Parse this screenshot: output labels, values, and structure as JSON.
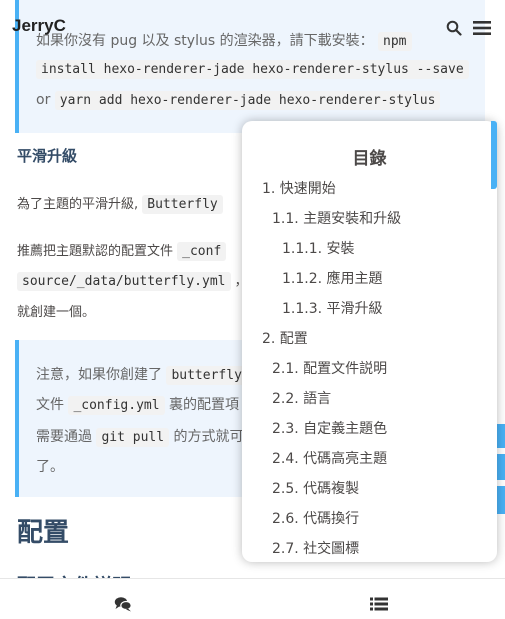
{
  "header": {
    "site_name": "JerryC"
  },
  "article": {
    "note1": {
      "line1": "如果你沒有 pug 以及 stylus 的渲染器，請下載安裝：",
      "line1_code": "npm",
      "line2_code": "install hexo-renderer-jade hexo-renderer-stylus --save",
      "line3_or": "or",
      "line3_code": "yarn add hexo-renderer-jade hexo-renderer-stylus"
    },
    "heading_smooth": "平滑升級",
    "para1_text": "為了主題的平滑升級,",
    "para1_code": "Butterfly",
    "para2_text": "推薦把主題默認的配置文件",
    "para2_code": "_conf",
    "para3_code": "source/_data/butterfly.yml",
    "para3_suffix": "，",
    "para4_text": "就創建一個。",
    "note2": {
      "l1_text": "注意，如果你創建了",
      "l1_code": "butterfly",
      "l2_text": "文件",
      "l2_code": "_config.yml",
      "l2_suffix": "裏的配置項",
      "l3_text": "需要通過",
      "l3_code": "git pull",
      "l3_suffix": "的方式就可",
      "l4_text": "了。"
    },
    "heading_config": "配置",
    "heading_config_file": "配置文件説明"
  },
  "toc": {
    "title": "目錄",
    "items": [
      "1. 快速開始",
      "1.1. 主題安裝和升級",
      "1.1.1. 安裝",
      "1.1.2. 應用主題",
      "1.1.3. 平滑升級",
      "2. 配置",
      "2.1. 配置文件説明",
      "2.2. 語言",
      "2.3. 自定義主題色",
      "2.4. 代碼高亮主題",
      "2.5. 代碼複製",
      "2.6. 代碼換行",
      "2.7. 社交圖標"
    ]
  },
  "icons": {
    "search": "search-icon",
    "menu": "menu-icon",
    "comment": "comment-icon",
    "toc": "list-icon"
  },
  "colors": {
    "accent": "#49b1f5",
    "note_bg": "#eef5fd",
    "heading": "#344c67"
  }
}
